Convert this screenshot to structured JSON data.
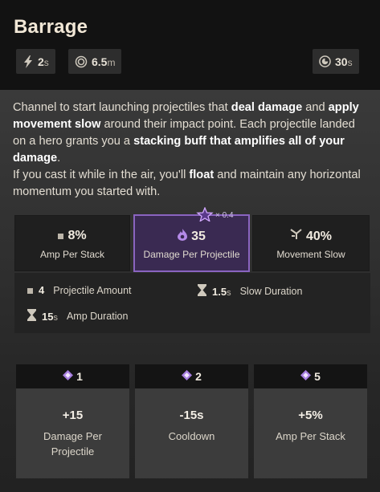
{
  "ability": {
    "title": "Barrage",
    "chips": {
      "channel": {
        "value": "2",
        "unit": "s",
        "icon": "lightning-icon"
      },
      "radius": {
        "value": "6.5",
        "unit": "m",
        "icon": "radius-icon"
      },
      "cooldown": {
        "value": "30",
        "unit": "s",
        "icon": "cooldown-icon"
      }
    }
  },
  "description": {
    "p1_a": "Channel to start launching projectiles that ",
    "p1_b": "deal damage",
    "p1_c": " and ",
    "p1_d": "apply movement slow",
    "p1_e": " around their impact point. Each projectile landed on a hero grants you a ",
    "p1_f": "stacking buff that amplifies all of your damage",
    "p1_g": ".",
    "p2_a": "If you cast it while in the air, you'll ",
    "p2_b": "float",
    "p2_c": " and maintain any horizontal momentum you started with."
  },
  "stats": [
    {
      "value": "8%",
      "label": "Amp Per Stack",
      "icon": "square-icon"
    },
    {
      "value": "35",
      "label": "Damage Per Projectile",
      "icon": "spirit-flame-icon",
      "multiplier": "× 0.4"
    },
    {
      "value": "40%",
      "label": "Movement Slow",
      "icon": "slow-icon"
    }
  ],
  "extra": {
    "projectile_amount": {
      "value": "4",
      "label": "Projectile Amount"
    },
    "slow_duration": {
      "value": "1.5",
      "unit": "s",
      "label": "Slow Duration"
    },
    "amp_duration": {
      "value": "15",
      "unit": "s",
      "label": "Amp Duration"
    }
  },
  "upgrades": [
    {
      "tier": "1",
      "value": "+15",
      "label": "Damage Per Projectile"
    },
    {
      "tier": "2",
      "value": "-15s",
      "label": "Cooldown"
    },
    {
      "tier": "5",
      "value": "+5%",
      "label": "Amp Per Stack"
    }
  ],
  "colors": {
    "accent_purple": "#8a64c0",
    "highlight_bg": "#3a2a52"
  }
}
